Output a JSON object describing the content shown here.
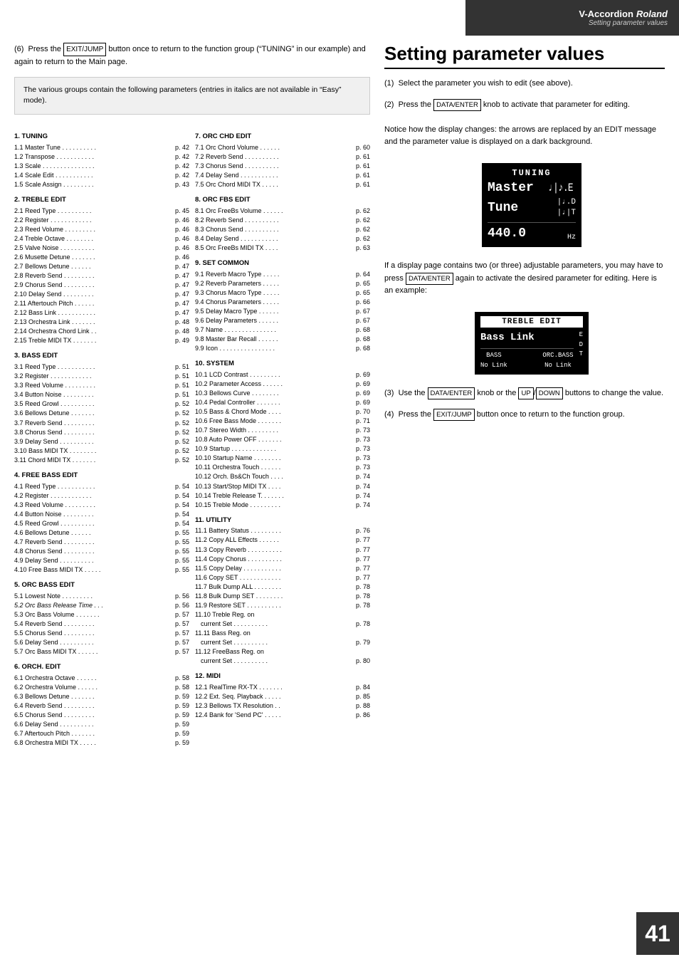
{
  "header": {
    "product": "V-Accordion",
    "brand": "Roland",
    "subtitle": "Setting parameter values"
  },
  "page_number": "41",
  "intro": {
    "step6": "Press the EXIT/JUMP button once to return to the function group (\"TUNING\" in our example) and again to return to the Main page.",
    "grey_box": "The various groups contain the following parameters (entries in italics are not available in \"Easy\" mode)."
  },
  "toc": {
    "col1": [
      {
        "section": "1. TUNING",
        "items": [
          {
            "label": "1.1 Master Tune",
            "dots": true,
            "page": "p. 42"
          },
          {
            "label": "1.2 Transpose",
            "dots": true,
            "page": "p. 42"
          },
          {
            "label": "1.3 Scale",
            "dots": true,
            "page": "p. 42"
          },
          {
            "label": "1.4 Scale Edit",
            "dots": true,
            "page": "p. 42"
          },
          {
            "label": "1.5 Scale Assign",
            "dots": true,
            "page": "p. 43"
          }
        ]
      },
      {
        "section": "2. TREBLE EDIT",
        "items": [
          {
            "label": "2.1 Reed Type",
            "dots": true,
            "page": "p. 45"
          },
          {
            "label": "2.2 Register",
            "dots": true,
            "page": "p. 46"
          },
          {
            "label": "2.3 Reed Volume",
            "dots": true,
            "page": "p. 46"
          },
          {
            "label": "2.4 Treble Octave",
            "dots": true,
            "page": "p. 46"
          },
          {
            "label": "2.5 Valve Noise",
            "dots": true,
            "page": "p. 46"
          },
          {
            "label": "2.6 Musette Detune",
            "dots": true,
            "page": "p. 46"
          },
          {
            "label": "2.7 Bellows Detune",
            "dots": true,
            "page": "p. 47"
          },
          {
            "label": "2.8 Reverb Send",
            "dots": true,
            "page": "p. 47"
          },
          {
            "label": "2.9 Chorus Send",
            "dots": true,
            "page": "p. 47"
          },
          {
            "label": "2.10 Delay Send",
            "dots": true,
            "page": "p. 47"
          },
          {
            "label": "2.11 Aftertouch Pitch",
            "dots": true,
            "page": "p. 47"
          },
          {
            "label": "2.12 Bass Link",
            "dots": true,
            "page": "p. 47"
          },
          {
            "label": "2.13 Orchestra Link",
            "dots": true,
            "page": "p. 48"
          },
          {
            "label": "2.14 Orchestra Chord Link",
            "dots": true,
            "page": "p. 48"
          },
          {
            "label": "2.15 Treble MIDI TX",
            "dots": true,
            "page": "p. 49"
          }
        ]
      },
      {
        "section": "3. BASS EDIT",
        "items": [
          {
            "label": "3.1 Reed Type",
            "dots": true,
            "page": "p. 51"
          },
          {
            "label": "3.2 Register",
            "dots": true,
            "page": "p. 51"
          },
          {
            "label": "3.3 Reed Volume",
            "dots": true,
            "page": "p. 51"
          },
          {
            "label": "3.4 Button Noise",
            "dots": true,
            "page": "p. 51"
          },
          {
            "label": "3.5 Reed Growl",
            "dots": true,
            "page": "p. 52"
          },
          {
            "label": "3.6 Bellows Detune",
            "dots": true,
            "page": "p. 52"
          },
          {
            "label": "3.7 Reverb Send",
            "dots": true,
            "page": "p. 52"
          },
          {
            "label": "3.8 Chorus Send",
            "dots": true,
            "page": "p. 52"
          },
          {
            "label": "3.9 Delay Send",
            "dots": true,
            "page": "p. 52"
          },
          {
            "label": "3.10 Bass MIDI TX",
            "dots": true,
            "page": "p. 52"
          },
          {
            "label": "3.11 Chord MIDI TX",
            "dots": true,
            "page": "p. 52"
          }
        ]
      },
      {
        "section": "4. FREE BASS EDIT",
        "items": [
          {
            "label": "4.1 Reed Type",
            "dots": true,
            "page": "p. 54"
          },
          {
            "label": "4.2 Register",
            "dots": true,
            "page": "p. 54"
          },
          {
            "label": "4.3 Reed Volume",
            "dots": true,
            "page": "p. 54"
          },
          {
            "label": "4.4 Button Noise",
            "dots": true,
            "page": "p. 54"
          },
          {
            "label": "4.5 Reed Growl",
            "dots": true,
            "page": "p. 54"
          },
          {
            "label": "4.6 Bellows Detune",
            "dots": true,
            "page": "p. 55"
          },
          {
            "label": "4.7 Reverb Send",
            "dots": true,
            "page": "p. 55"
          },
          {
            "label": "4.8 Chorus Send",
            "dots": true,
            "page": "p. 55"
          },
          {
            "label": "4.9 Delay Send",
            "dots": true,
            "page": "p. 55"
          },
          {
            "label": "4.10 Free Bass MIDI TX",
            "dots": true,
            "page": "p. 55"
          }
        ]
      },
      {
        "section": "5. ORC BASS EDIT",
        "items": [
          {
            "label": "5.1 Lowest Note",
            "dots": true,
            "page": "p. 56"
          },
          {
            "label": "5.2 Orc Bass Release Time",
            "dots": true,
            "page": "p. 56"
          },
          {
            "label": "5.3 Orc Bass Volume",
            "dots": true,
            "page": "p. 57"
          },
          {
            "label": "5.4 Reverb Send",
            "dots": true,
            "page": "p. 57"
          },
          {
            "label": "5.5 Chorus Send",
            "dots": true,
            "page": "p. 57"
          },
          {
            "label": "5.6 Delay Send",
            "dots": true,
            "page": "p. 57"
          },
          {
            "label": "5.7 Orc Bass MIDI TX",
            "dots": true,
            "page": "p. 57"
          }
        ]
      },
      {
        "section": "6. ORCH. EDIT",
        "items": [
          {
            "label": "6.1 Orchestra Octave",
            "dots": true,
            "page": "p. 58"
          },
          {
            "label": "6.2 Orchestra Volume",
            "dots": true,
            "page": "p. 58"
          },
          {
            "label": "6.3 Bellows Detune",
            "dots": true,
            "page": "p. 59"
          },
          {
            "label": "6.4 Reverb Send",
            "dots": true,
            "page": "p. 59"
          },
          {
            "label": "6.5 Chorus Send",
            "dots": true,
            "page": "p. 59"
          },
          {
            "label": "6.6 Delay Send",
            "dots": true,
            "page": "p. 59"
          },
          {
            "label": "6.7 Aftertouch Pitch",
            "dots": true,
            "page": "p. 59"
          },
          {
            "label": "6.8 Orchestra MIDI TX",
            "dots": true,
            "page": "p. 59"
          }
        ]
      }
    ],
    "col2": [
      {
        "section": "7. ORC CHD EDIT",
        "items": [
          {
            "label": "7.1 Orc Chord Volume",
            "dots": true,
            "page": "p. 60"
          },
          {
            "label": "7.2 Reverb Send",
            "dots": true,
            "page": "p. 61"
          },
          {
            "label": "7.3 Chorus Send",
            "dots": true,
            "page": "p. 61"
          },
          {
            "label": "7.4 Delay Send",
            "dots": true,
            "page": "p. 61"
          },
          {
            "label": "7.5 Orc Chord MIDI TX",
            "dots": true,
            "page": "p. 61"
          }
        ]
      },
      {
        "section": "8. ORC FBS EDIT",
        "items": [
          {
            "label": "8.1 Orc FreeBs Volume",
            "dots": true,
            "page": "p. 62"
          },
          {
            "label": "8.2 Reverb Send",
            "dots": true,
            "page": "p. 62"
          },
          {
            "label": "8.3 Chorus Send",
            "dots": true,
            "page": "p. 62"
          },
          {
            "label": "8.4 Delay Send",
            "dots": true,
            "page": "p. 62"
          },
          {
            "label": "8.5 Orc FreeBs MIDI TX",
            "dots": true,
            "page": "p. 63"
          }
        ]
      },
      {
        "section": "9. SET COMMON",
        "items": [
          {
            "label": "9.1 Reverb Macro Type",
            "dots": true,
            "page": "p. 64"
          },
          {
            "label": "9.2 Reverb Parameters",
            "dots": true,
            "page": "p. 65"
          },
          {
            "label": "9.3 Chorus Macro Type",
            "dots": true,
            "page": "p. 65"
          },
          {
            "label": "9.4 Chorus Parameters",
            "dots": true,
            "page": "p. 66"
          },
          {
            "label": "9.5 Delay Macro Type",
            "dots": true,
            "page": "p. 67"
          },
          {
            "label": "9.6 Delay Parameters",
            "dots": true,
            "page": "p. 67"
          },
          {
            "label": "9.7 Name",
            "dots": true,
            "page": "p. 68"
          },
          {
            "label": "9.8 Master Bar Recall",
            "dots": true,
            "page": "p. 68"
          },
          {
            "label": "9.9 Icon",
            "dots": true,
            "page": "p. 68"
          }
        ]
      },
      {
        "section": "10. SYSTEM",
        "items": [
          {
            "label": "10.1 LCD Contrast",
            "dots": true,
            "page": "p. 69"
          },
          {
            "label": "10.2 Parameter Access",
            "dots": true,
            "page": "p. 69"
          },
          {
            "label": "10.3 Bellows Curve",
            "dots": true,
            "page": "p. 69"
          },
          {
            "label": "10.4 Pedal Controller",
            "dots": true,
            "page": "p. 69"
          },
          {
            "label": "10.5 Bass & Chord Mode",
            "dots": true,
            "page": "p. 70"
          },
          {
            "label": "10.6 Free Bass Mode",
            "dots": true,
            "page": "p. 71"
          },
          {
            "label": "10.7 Stereo Width",
            "dots": true,
            "page": "p. 73"
          },
          {
            "label": "10.8 Auto Power OFF",
            "dots": true,
            "page": "p. 73"
          },
          {
            "label": "10.9 Startup",
            "dots": true,
            "page": "p. 73"
          },
          {
            "label": "10.10 Startup Name",
            "dots": true,
            "page": "p. 73"
          },
          {
            "label": "10.11 Orchestra Touch",
            "dots": true,
            "page": "p. 73"
          },
          {
            "label": "10.12 Orch. Bs&Ch Touch",
            "dots": true,
            "page": "p. 74"
          },
          {
            "label": "10.13 Start/Stop MIDI TX",
            "dots": true,
            "page": "p. 74"
          },
          {
            "label": "10.14 Treble Release T.",
            "dots": true,
            "page": "p. 74"
          },
          {
            "label": "10.15 Treble Mode",
            "dots": true,
            "page": "p. 74"
          }
        ]
      },
      {
        "section": "11. UTILITY",
        "items": [
          {
            "label": "11.1 Battery Status",
            "dots": true,
            "page": "p. 76"
          },
          {
            "label": "11.2 Copy ALL Effects",
            "dots": true,
            "page": "p. 77"
          },
          {
            "label": "11.3 Copy Reverb",
            "dots": true,
            "page": "p. 77"
          },
          {
            "label": "11.4 Copy Chorus",
            "dots": true,
            "page": "p. 77"
          },
          {
            "label": "11.5 Copy Delay",
            "dots": true,
            "page": "p. 77"
          },
          {
            "label": "11.6 Copy SET",
            "dots": true,
            "page": "p. 77"
          },
          {
            "label": "11.7 Bulk Dump ALL",
            "dots": true,
            "page": "p. 78"
          },
          {
            "label": "11.8 Bulk Dump SET",
            "dots": true,
            "page": "p. 78"
          },
          {
            "label": "11.9 Restore SET",
            "dots": true,
            "page": "p. 78"
          },
          {
            "label": "11.10 Treble Reg. on",
            "sub": "current Set",
            "dots": true,
            "page": "p. 78"
          },
          {
            "label": "11.11 Bass Reg. on",
            "sub": "current Set",
            "dots": true,
            "page": "p. 79"
          },
          {
            "label": "11.12 FreeBass Reg. on",
            "sub": "current Set",
            "dots": true,
            "page": "p. 80"
          }
        ]
      },
      {
        "section": "12. MIDI",
        "items": [
          {
            "label": "12.1 RealTime RX-TX",
            "dots": true,
            "page": "p. 84"
          },
          {
            "label": "12.2 Ext. Seq. Playback",
            "dots": true,
            "page": "p. 85"
          },
          {
            "label": "12.3 Bellows TX Resolution",
            "dots": true,
            "page": "p. 88"
          },
          {
            "label": "12.4 Bank for 'Send PC'",
            "dots": true,
            "page": "p. 86"
          }
        ]
      }
    ]
  },
  "right_section": {
    "title": "Setting parameter values",
    "steps": [
      {
        "num": "(1)",
        "text": "Select the parameter you wish to edit (see above)."
      },
      {
        "num": "(2)",
        "text": "Press the DATA/ENTER knob to activate that parameter for editing.",
        "note": "Notice how the display changes: the arrows are replaced by an EDIT message and the parameter value is displayed on a dark background."
      },
      {
        "num": "(3)",
        "text": "Use the DATA/ENTER knob or the UP/DOWN buttons to change the value."
      },
      {
        "num": "(4)",
        "text": "Press the EXIT/JUMP button once to return to the function group."
      }
    ],
    "lcd1": {
      "title": "TUNING",
      "row1": "Master",
      "row2": "Tune",
      "value": "440.0",
      "unit": "Hz"
    },
    "lcd2": {
      "title": "TREBLE EDIT",
      "main": "Bass Link",
      "bottom_left": "BASS\nNo Link",
      "bottom_right": "ORC.BASS\nNo Link",
      "letters": [
        "E",
        "D",
        "T"
      ]
    },
    "lcd_note": "If a display page contains two (or three) adjustable parameters, you may have to press DATA/ENTER again to activate the desired parameter for editing. Here is an example:"
  }
}
